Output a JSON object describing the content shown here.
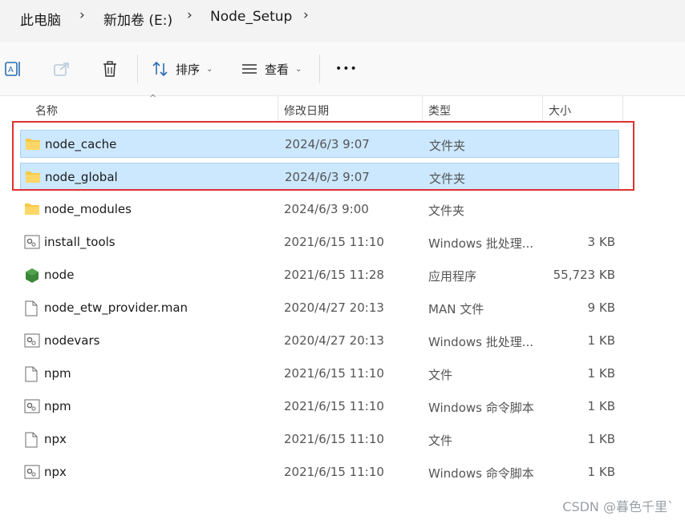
{
  "breadcrumb": {
    "items": [
      "此电脑",
      "新加卷 (E:)",
      "Node_Setup"
    ],
    "separator": "›"
  },
  "toolbar": {
    "sort_label": "排序",
    "view_label": "查看",
    "more_label": "•••"
  },
  "columns": {
    "name": "名称",
    "date": "修改日期",
    "type": "类型",
    "size": "大小"
  },
  "files": [
    {
      "name": "node_cache",
      "date": "2024/6/3 9:07",
      "type": "文件夹",
      "size": "",
      "icon": "folder-icon",
      "selected": true
    },
    {
      "name": "node_global",
      "date": "2024/6/3 9:07",
      "type": "文件夹",
      "size": "",
      "icon": "folder-icon",
      "selected": true
    },
    {
      "name": "node_modules",
      "date": "2024/6/3 9:00",
      "type": "文件夹",
      "size": "",
      "icon": "folder-icon",
      "selected": false
    },
    {
      "name": "install_tools",
      "date": "2021/6/15 11:10",
      "type": "Windows 批处理...",
      "size": "3 KB",
      "icon": "batch-file-icon",
      "selected": false
    },
    {
      "name": "node",
      "date": "2021/6/15 11:28",
      "type": "应用程序",
      "size": "55,723 KB",
      "icon": "node-app-icon",
      "selected": false
    },
    {
      "name": "node_etw_provider.man",
      "date": "2020/4/27 20:13",
      "type": "MAN 文件",
      "size": "9 KB",
      "icon": "file-icon",
      "selected": false
    },
    {
      "name": "nodevars",
      "date": "2020/4/27 20:13",
      "type": "Windows 批处理...",
      "size": "1 KB",
      "icon": "batch-file-icon",
      "selected": false
    },
    {
      "name": "npm",
      "date": "2021/6/15 11:10",
      "type": "文件",
      "size": "1 KB",
      "icon": "file-icon",
      "selected": false
    },
    {
      "name": "npm",
      "date": "2021/6/15 11:10",
      "type": "Windows 命令脚本",
      "size": "1 KB",
      "icon": "batch-file-icon",
      "selected": false
    },
    {
      "name": "npx",
      "date": "2021/6/15 11:10",
      "type": "文件",
      "size": "1 KB",
      "icon": "file-icon",
      "selected": false
    },
    {
      "name": "npx",
      "date": "2021/6/15 11:10",
      "type": "Windows 命令脚本",
      "size": "1 KB",
      "icon": "batch-file-icon",
      "selected": false
    }
  ],
  "colors": {
    "selection": "#cce8ff",
    "highlight_border": "#e03131",
    "folder": "#f7c948"
  },
  "watermark": "CSDN @暮色千里`"
}
